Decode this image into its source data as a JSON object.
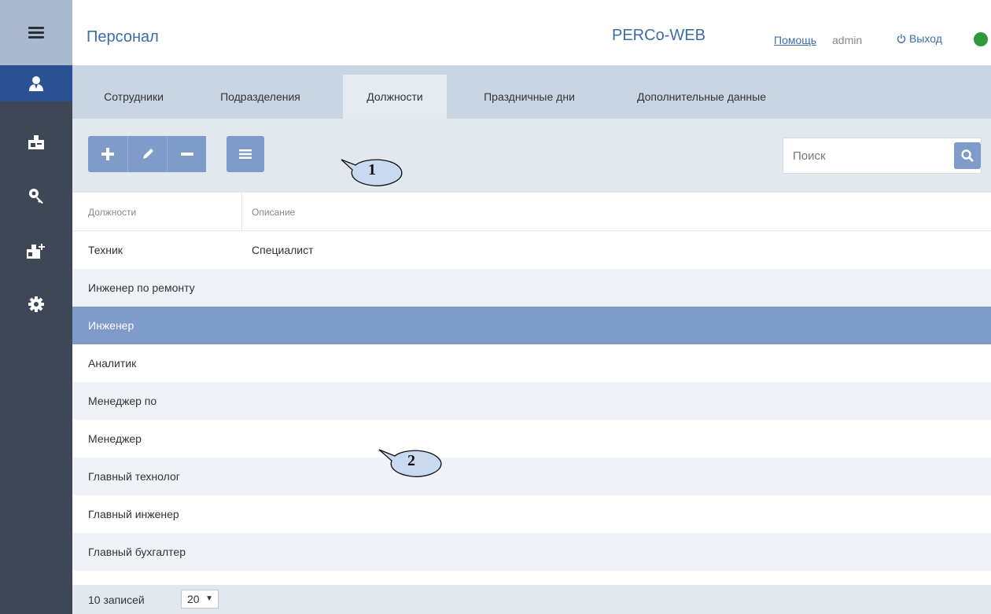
{
  "sidebar": {
    "items": [
      {
        "name": "personnel",
        "icon": "person-icon",
        "active": true
      },
      {
        "name": "access",
        "icon": "id-card-icon"
      },
      {
        "name": "keys",
        "icon": "key-icon"
      },
      {
        "name": "add-card",
        "icon": "add-card-icon"
      },
      {
        "name": "settings",
        "icon": "gear-icon"
      }
    ]
  },
  "header": {
    "title": "Персонал",
    "app_name": "PERCo-WEB",
    "help": "Помощь",
    "user": "admin",
    "logout": "Выход",
    "status_color": "#2f9a3a"
  },
  "tabs": [
    {
      "label": "Сотрудники"
    },
    {
      "label": "Подразделения"
    },
    {
      "label": "Должности",
      "active": true
    },
    {
      "label": "Праздничные дни"
    },
    {
      "label": "Дополнительные данные"
    }
  ],
  "toolbar": {
    "search_placeholder": "Поиск"
  },
  "callouts": {
    "one": "1",
    "two": "2"
  },
  "table": {
    "columns": [
      "Должности",
      "Описание"
    ],
    "rows": [
      {
        "position": "Техник",
        "description": "Специалист"
      },
      {
        "position": "Инженер по ремонту",
        "description": ""
      },
      {
        "position": "Инженер",
        "description": "",
        "selected": true
      },
      {
        "position": "Аналитик",
        "description": ""
      },
      {
        "position": "Менеджер по",
        "description": ""
      },
      {
        "position": "Менеджер",
        "description": ""
      },
      {
        "position": "Главный технолог",
        "description": ""
      },
      {
        "position": "Главный инженер",
        "description": ""
      },
      {
        "position": "Главный бухгалтер",
        "description": ""
      }
    ]
  },
  "footer": {
    "records": "10 записей",
    "page_size": "20"
  },
  "colors": {
    "accent": "#3d6ca8",
    "button": "#7e9bc9",
    "sidebar": "#3e4756",
    "sidebar_active": "#2a5194"
  }
}
